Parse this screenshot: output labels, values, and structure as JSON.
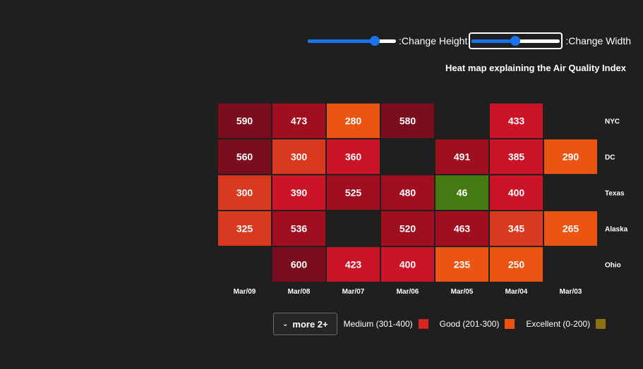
{
  "controls": {
    "height_label": ":Change Height",
    "width_label": ":Change Width",
    "height_value": 0.76,
    "width_value": 0.5
  },
  "chart_data": {
    "type": "heatmap",
    "title": "Heat map explaining the Air Quality Index",
    "x_categories": [
      "Mar/09",
      "Mar/08",
      "Mar/07",
      "Mar/06",
      "Mar/05",
      "Mar/04",
      "Mar/03"
    ],
    "y_categories": [
      "NYC",
      "DC",
      "Texas",
      "Alaska",
      "Ohio"
    ],
    "values": [
      [
        590,
        473,
        280,
        580,
        null,
        433,
        null
      ],
      [
        560,
        300,
        360,
        null,
        491,
        385,
        290
      ],
      [
        300,
        390,
        525,
        480,
        46,
        400,
        null
      ],
      [
        325,
        536,
        null,
        520,
        463,
        345,
        265
      ],
      [
        null,
        600,
        423,
        400,
        235,
        250,
        null
      ]
    ],
    "colors": {
      "very_high": "#7a0e1e",
      "high": "#9f0f20",
      "medium": "#cc1428",
      "medium_low": "#d9391e",
      "good": "#ec5412",
      "excellent": "#457a12"
    },
    "legend": {
      "more_label": "more 2+",
      "items": [
        {
          "label": "Medium (301-400)",
          "color": "#d7251f"
        },
        {
          "label": "Good (201-300)",
          "color": "#ec5412"
        },
        {
          "label": "Excellent (0-200)",
          "color": "#8a7312"
        }
      ]
    }
  }
}
